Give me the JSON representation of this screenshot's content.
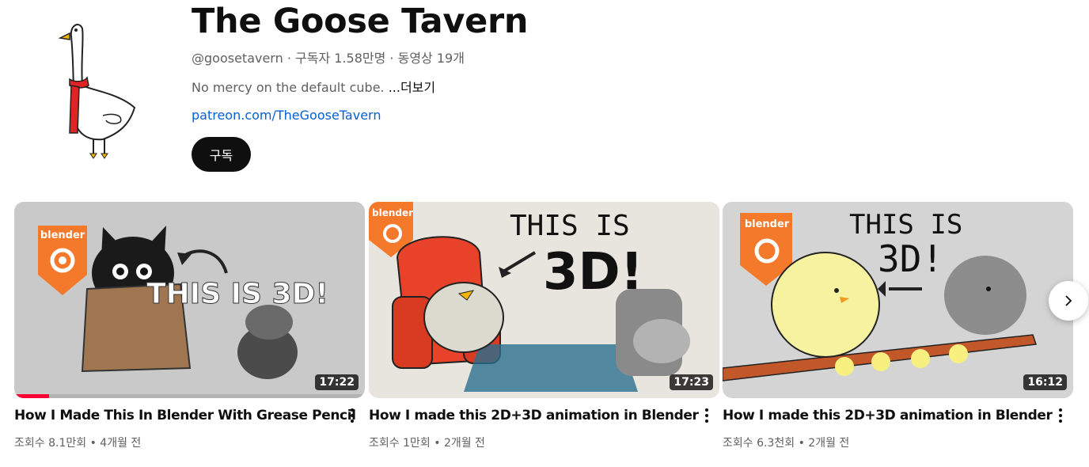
{
  "channel": {
    "name": "The Goose Tavern",
    "handle": "@goosetavern",
    "sep1": " · ",
    "subscribers": "구독자 1.58만명",
    "sep2": " · ",
    "video_count": "동영상 19개",
    "description": "No mercy on the default cube. ",
    "more_label": "...더보기",
    "link": "patreon.com/TheGooseTavern",
    "subscribe_label": "구독"
  },
  "videos": [
    {
      "title": "How I Made This In Blender With Grease Pencil",
      "views": "조회수 8.1만회",
      "sep": " • ",
      "age": "4개월 전",
      "duration": "17:22",
      "watch_progress": 0.1,
      "thumb_logo": "blender",
      "thumb_text": "THIS IS 3D!"
    },
    {
      "title": "How I made this 2D+3D animation in Blender",
      "views": "조회수 1만회",
      "sep": " • ",
      "age": "2개월 전",
      "duration": "17:23",
      "thumb_logo": "blender",
      "thumb_text_1": "THIS IS",
      "thumb_text_2": "3D!"
    },
    {
      "title": "How I made this 2D+3D animation in Blender",
      "views": "조회수 6.3천회",
      "sep": " • ",
      "age": "2개월 전",
      "duration": "16:12",
      "thumb_logo": "blender",
      "thumb_text_1": "THIS IS",
      "thumb_text_2": "3D!"
    }
  ],
  "icons": {
    "avatar": "goose-avatar",
    "next": "chevron-right-icon",
    "menu": "more-vert-icon"
  },
  "colors": {
    "subscribe_bg": "#0f0f0f",
    "link": "#065fd4",
    "progress": "#ff0033",
    "blender_orange": "#f5792a"
  }
}
